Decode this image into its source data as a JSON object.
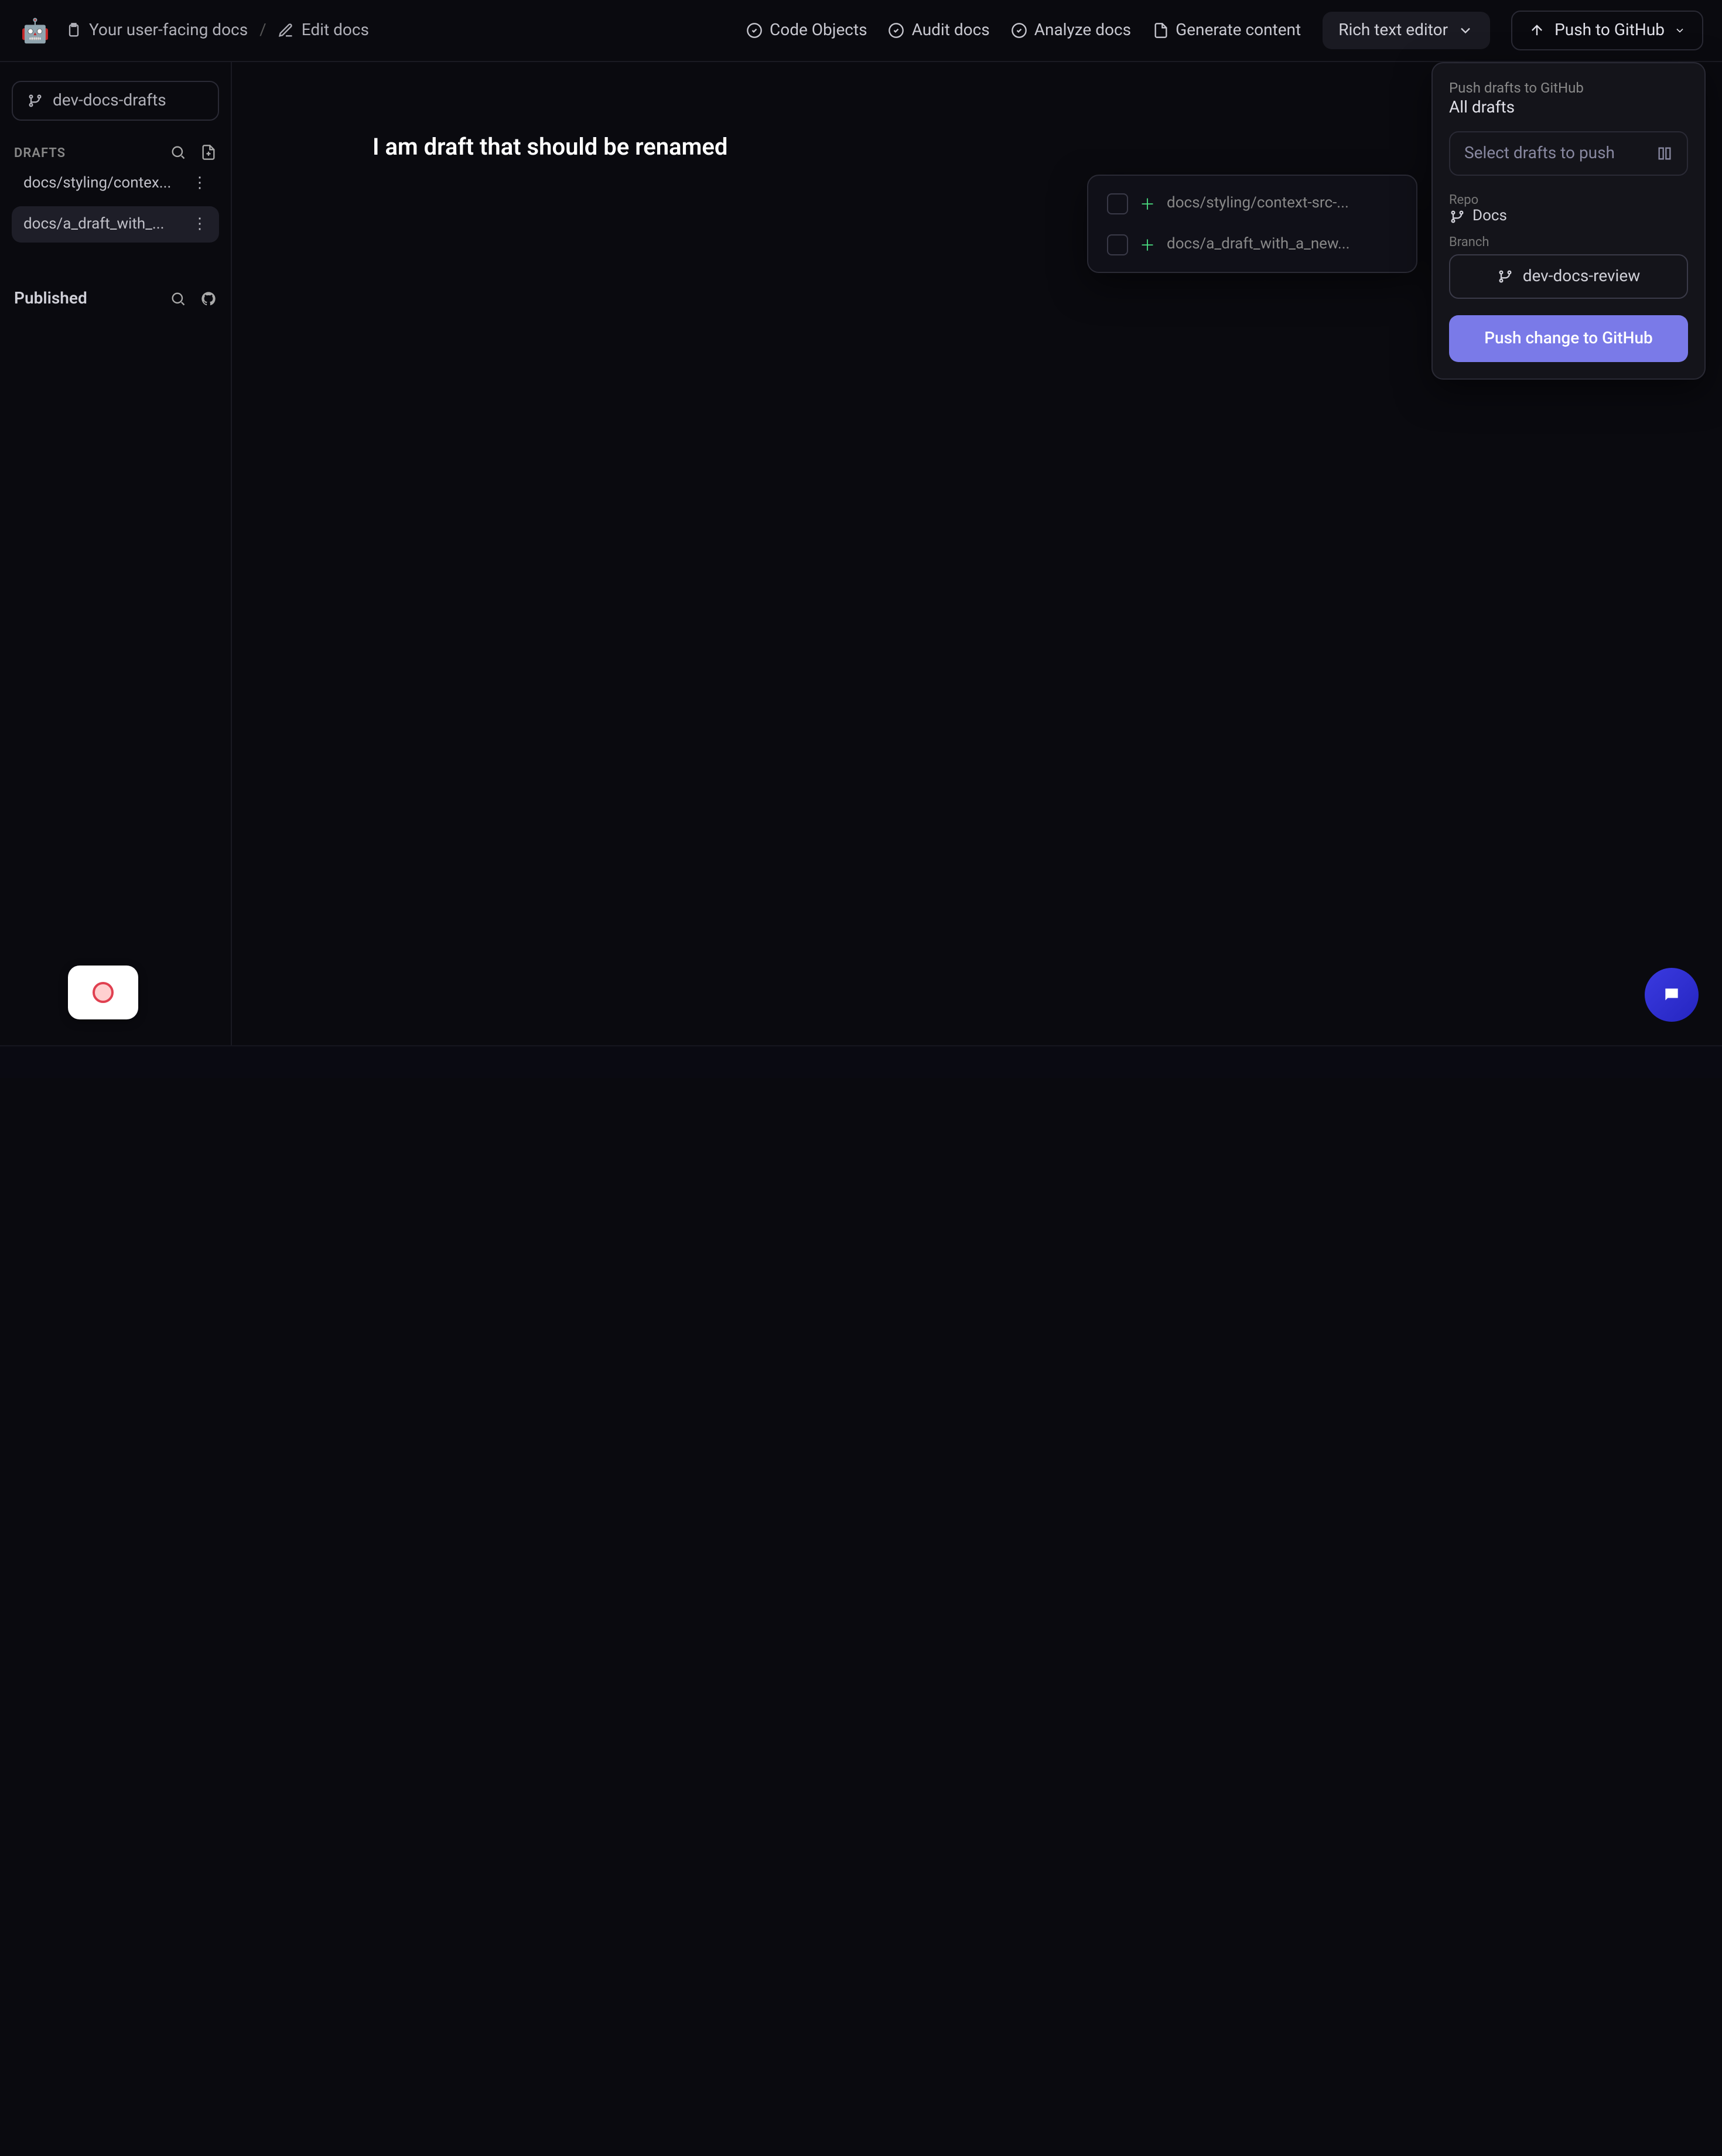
{
  "breadcrumb": {
    "docs": "Your user-facing docs",
    "edit": "Edit docs"
  },
  "top_actions": {
    "code_objects": "Code Objects",
    "audit_docs": "Audit docs",
    "analyze_docs": "Analyze docs",
    "generate_content": "Generate content"
  },
  "editor_mode": "Rich text editor",
  "push_button": "Push to GitHub",
  "sidebar": {
    "branch": "dev-docs-drafts",
    "drafts_header": "DRAFTS",
    "drafts": [
      {
        "name": "docs/styling/contex..."
      },
      {
        "name": "docs/a_draft_with_..."
      }
    ],
    "published_header": "Published"
  },
  "document": {
    "title": "I am draft that should be renamed"
  },
  "push_panel": {
    "title": "Push drafts to GitHub",
    "subtitle": "All drafts",
    "select_placeholder": "Select drafts to push",
    "repo_label": "Repo",
    "repo_value": "Docs",
    "branch_label": "Branch",
    "branch_value": "dev-docs-review",
    "push_change": "Push change to GitHub"
  },
  "drafts_popover": [
    {
      "name": "docs/styling/context-src-..."
    },
    {
      "name": "docs/a_draft_with_a_new..."
    }
  ]
}
